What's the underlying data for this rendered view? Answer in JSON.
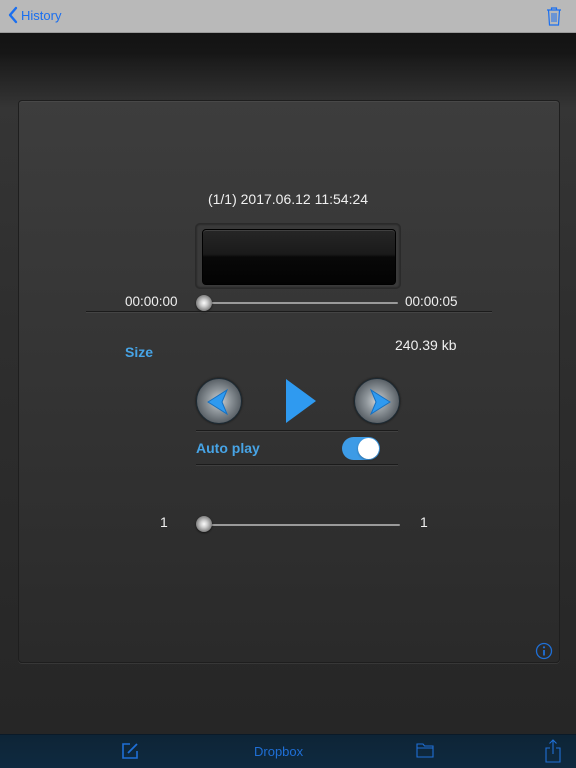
{
  "navbar": {
    "back_label": "History",
    "back_icon": "chevron-left-icon",
    "trash_icon": "trash-icon"
  },
  "player": {
    "title": "(1/1) 2017.06.12 11:54:24",
    "time_start": "00:00:00",
    "time_end": "00:00:05",
    "progress": 0.0,
    "size_label": "Size",
    "size_value": "240.39  kb",
    "prev_icon": "previous-icon",
    "play_icon": "play-icon",
    "next_icon": "next-icon",
    "auto_play_label": "Auto play",
    "auto_play_on": true,
    "speed_min": "1",
    "speed_max": "1",
    "speed_value": 0.0
  },
  "info_icon": "info-icon",
  "toolbar": {
    "compose_icon": "compose-icon",
    "dropbox_label": "Dropbox",
    "folder_icon": "folder-icon",
    "share_icon": "share-icon"
  },
  "colors": {
    "accent": "#1a6ff0",
    "label_blue": "#47a4e6",
    "toggle_on": "#3d9be6",
    "navbar_bg": "#b9b9b9",
    "toolbar_bg": "#0f2a40"
  }
}
